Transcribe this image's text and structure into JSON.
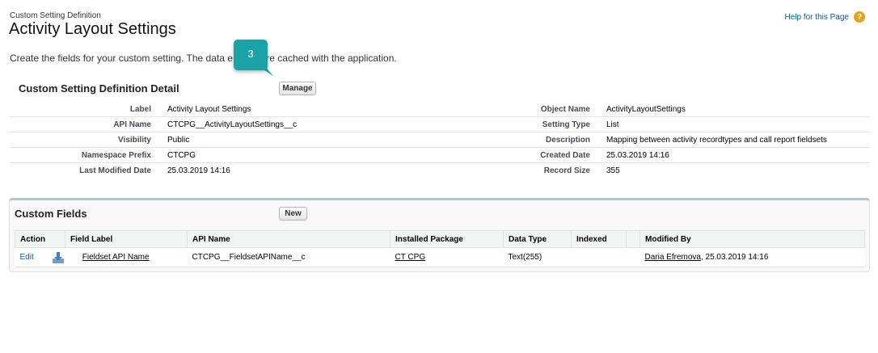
{
  "header": {
    "breadcrumb": "Custom Setting Definition",
    "title": "Activity Layout Settings",
    "help_label": "Help for this Page",
    "help_icon": "question-icon"
  },
  "intro": "Create the fields for your custom setting. The data                e fields are cached with the application.",
  "tooltip": {
    "number": "3",
    "color": "#1ba2a6"
  },
  "detail": {
    "title": "Custom Setting Definition Detail",
    "manage_label": "Manage",
    "rows": [
      {
        "l1": "Label",
        "v1": "Activity Layout Settings",
        "l2": "Object Name",
        "v2": "ActivityLayoutSettings"
      },
      {
        "l1": "API Name",
        "v1": "CTCPG__ActivityLayoutSettings__c",
        "l2": "Setting Type",
        "v2": "List"
      },
      {
        "l1": "Visibility",
        "v1": "Public",
        "l2": "Description",
        "v2": "Mapping between activity recordtypes and call report fieldsets"
      },
      {
        "l1": "Namespace Prefix",
        "v1": "CTCPG",
        "l2": "Created Date",
        "v2": "25.03.2019 14:16"
      },
      {
        "l1": "Last Modified Date",
        "v1": "25.03.2019 14:16",
        "l2": "Record Size",
        "v2": "355"
      }
    ]
  },
  "custom_fields": {
    "title": "Custom Fields",
    "new_label": "New",
    "columns": [
      "Action",
      "Field Label",
      "API Name",
      "Installed Package",
      "Data Type",
      "Indexed",
      "",
      "Modified By"
    ],
    "rows": [
      {
        "action": "Edit",
        "icon": "download-icon",
        "field_label": "Fieldset API Name",
        "api_name": "CTCPG__FieldsetAPIName__c",
        "installed_package": "CT CPG",
        "data_type": "Text(255)",
        "indexed": "",
        "modified_by_name": "Daria Efremova",
        "modified_by_date": ", 25.03.2019 14:16"
      }
    ]
  }
}
